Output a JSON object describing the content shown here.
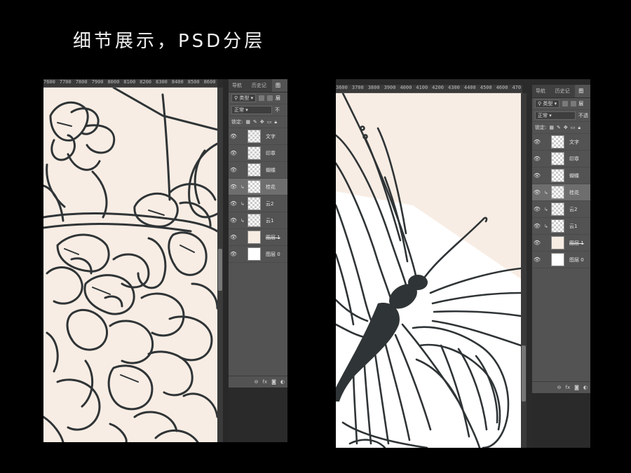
{
  "page_title": "细节展示，PSD分层",
  "screenshots": [
    {
      "ruler_ticks": [
        "7600",
        "7700",
        "7800",
        "7900",
        "8000",
        "8100",
        "8200",
        "8300",
        "8400",
        "8500",
        "8600"
      ],
      "panel": {
        "tabs": [
          "导航器",
          "历史记录",
          "图层"
        ],
        "filter_label": "类型",
        "blend_mode": "正常",
        "opacity_cut": "不",
        "lock_label": "锁定:",
        "layers": [
          {
            "name": "文字",
            "thumb": "checker",
            "clip": false,
            "selected": false,
            "strike": false
          },
          {
            "name": "印章",
            "thumb": "checker",
            "clip": false,
            "selected": false,
            "strike": false
          },
          {
            "name": "蝴蝶",
            "thumb": "checker",
            "clip": false,
            "selected": false,
            "strike": false
          },
          {
            "name": "桂花",
            "thumb": "checker",
            "clip": true,
            "selected": true,
            "strike": false
          },
          {
            "name": "云2",
            "thumb": "checker",
            "clip": true,
            "selected": false,
            "strike": false
          },
          {
            "name": "云1",
            "thumb": "checker",
            "clip": true,
            "selected": false,
            "strike": false
          },
          {
            "name": "图层 1",
            "thumb": "cream",
            "clip": false,
            "selected": false,
            "strike": true
          },
          {
            "name": "图层 0",
            "thumb": "white",
            "clip": false,
            "selected": false,
            "strike": false
          }
        ],
        "footer_icons": [
          "link-icon",
          "fx-icon",
          "mask-icon",
          "adjust-icon"
        ],
        "fx_label": "fx"
      },
      "canvas_color": "#f8ede4"
    },
    {
      "ruler_ticks": [
        "3600",
        "3700",
        "3800",
        "3900",
        "4000",
        "4100",
        "4200",
        "4300",
        "4400",
        "4500",
        "4600",
        "470"
      ],
      "panel": {
        "tabs": [
          "导航器",
          "历史记录",
          "图层"
        ],
        "filter_label": "类型",
        "blend_mode": "正常",
        "opacity_cut": "不透",
        "lock_label": "锁定:",
        "layers": [
          {
            "name": "文字",
            "thumb": "checker",
            "clip": false,
            "selected": false,
            "strike": false
          },
          {
            "name": "印章",
            "thumb": "checker",
            "clip": false,
            "selected": false,
            "strike": false
          },
          {
            "name": "蝴蝶",
            "thumb": "checker",
            "clip": false,
            "selected": false,
            "strike": false
          },
          {
            "name": "桂花",
            "thumb": "checker",
            "clip": true,
            "selected": true,
            "strike": false
          },
          {
            "name": "云2",
            "thumb": "checker",
            "clip": true,
            "selected": false,
            "strike": false
          },
          {
            "name": "云1",
            "thumb": "checker",
            "clip": true,
            "selected": false,
            "strike": false
          },
          {
            "name": "图层 1",
            "thumb": "cream",
            "clip": false,
            "selected": false,
            "strike": true
          },
          {
            "name": "图层 0",
            "thumb": "white",
            "clip": false,
            "selected": false,
            "strike": false
          }
        ],
        "footer_icons": [
          "link-icon",
          "fx-icon",
          "mask-icon",
          "adjust-icon"
        ],
        "fx_label": "fx"
      },
      "canvas_color": "#f8ede4"
    }
  ],
  "colors": {
    "background": "#000000",
    "line_art": "#2f3436",
    "panel": "#535353",
    "cream": "#f8ede4"
  }
}
